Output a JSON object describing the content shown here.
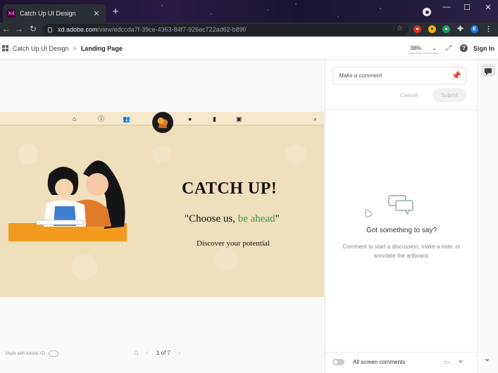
{
  "browser": {
    "tab_title": "Catch Up UI Design",
    "tab_close": "✕",
    "new_tab": "+",
    "url_host": "xd.adobe.com",
    "url_path": "/view/edccda7f-39ce-4363-84f7-926ec722ad62-b89f/",
    "window_controls": [
      "—",
      "☐",
      "✕"
    ],
    "extension_letter": "E",
    "icons": [
      "back-icon",
      "forward-icon",
      "reload-icon",
      "lock-icon",
      "star-icon",
      "extensions-icon",
      "menu-icon"
    ]
  },
  "xd_header": {
    "breadcrumb_project": "Catch Up UI Design",
    "breadcrumb_separator": ">",
    "breadcrumb_page": "Landing Page",
    "zoom_value": "38%",
    "sign_in": "Sign In",
    "help": "?"
  },
  "artboard": {
    "nav_icons": [
      "home-icon",
      "info-icon",
      "group-icon",
      "profile-icon",
      "book-icon",
      "badge-icon",
      "search-icon"
    ],
    "title": "CATCH UP!",
    "quote_open": "\"Choose us, ",
    "quote_highlight": "be ahead",
    "quote_close": "\"",
    "tagline": "Discover your potential",
    "colors": {
      "background": "#efdfbd",
      "accent_green": "#3f9a3a",
      "banner_orange": "#f39a1e"
    }
  },
  "footer": {
    "made_with": "Made with Adobe XD",
    "page_indicator": "1 of 7"
  },
  "comments": {
    "placeholder": "Make a comment",
    "cancel": "Cancel",
    "submit": "Submit",
    "empty_title": "Got something to say?",
    "empty_desc": "Comment to start a discussion, make a note, or annotate the artboard.",
    "toggle_label": "All screen comments"
  }
}
